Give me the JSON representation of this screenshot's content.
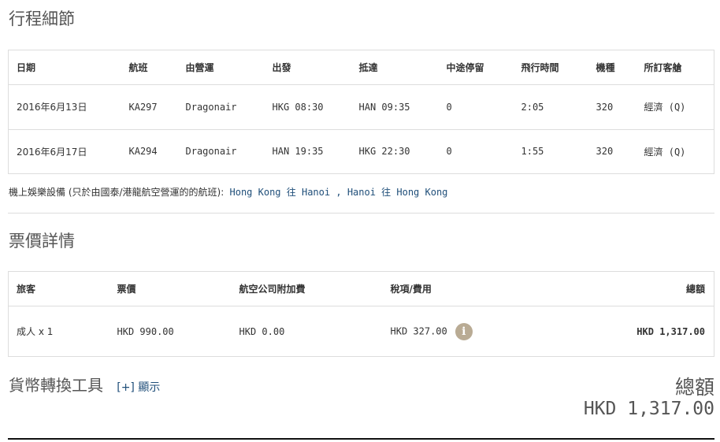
{
  "itinerary": {
    "title": "行程細節",
    "headers": [
      "日期",
      "航班",
      "由營運",
      "出發",
      "抵達",
      "中途停留",
      "飛行時間",
      "機種",
      "所訂客艙"
    ],
    "rows": [
      {
        "date": "2016年6月13日",
        "flight": "KA297",
        "operator": "Dragonair",
        "depart": "HKG 08:30",
        "arrive": "HAN 09:35",
        "stops": "0",
        "duration": "2:05",
        "aircraft": "320",
        "cabin": "經濟 (Q)"
      },
      {
        "date": "2016年6月17日",
        "flight": "KA294",
        "operator": "Dragonair",
        "depart": "HAN 19:35",
        "arrive": "HKG 22:30",
        "stops": "0",
        "duration": "1:55",
        "aircraft": "320",
        "cabin": "經濟 (Q)"
      }
    ],
    "ife": {
      "label": "機上娛樂設備 (只於由國泰/港龍航空營運的的航班):",
      "link1": "Hong Kong 往 Hanoi",
      "sep": ",",
      "link2": "Hanoi 往 Hong Kong"
    }
  },
  "fare": {
    "title": "票價詳情",
    "headers": [
      "旅客",
      "票價",
      "航空公司附加費",
      "稅項/費用",
      "總額"
    ],
    "row": {
      "passenger": "成人 x 1",
      "fare": "HKD 990.00",
      "surcharge": "HKD 0.00",
      "taxes": "HKD 327.00",
      "total": "HKD 1,317.00"
    },
    "info_icon": "info-icon",
    "info_glyph": "i"
  },
  "currency": {
    "title": "貨幣轉換工具",
    "toggle": "[+] 顯示"
  },
  "grand_total": {
    "label": "總額",
    "value": "HKD 1,317.00"
  },
  "colors": {
    "link": "#1f4e79",
    "info_icon": "#b9ab94",
    "border": "#dddddd"
  }
}
